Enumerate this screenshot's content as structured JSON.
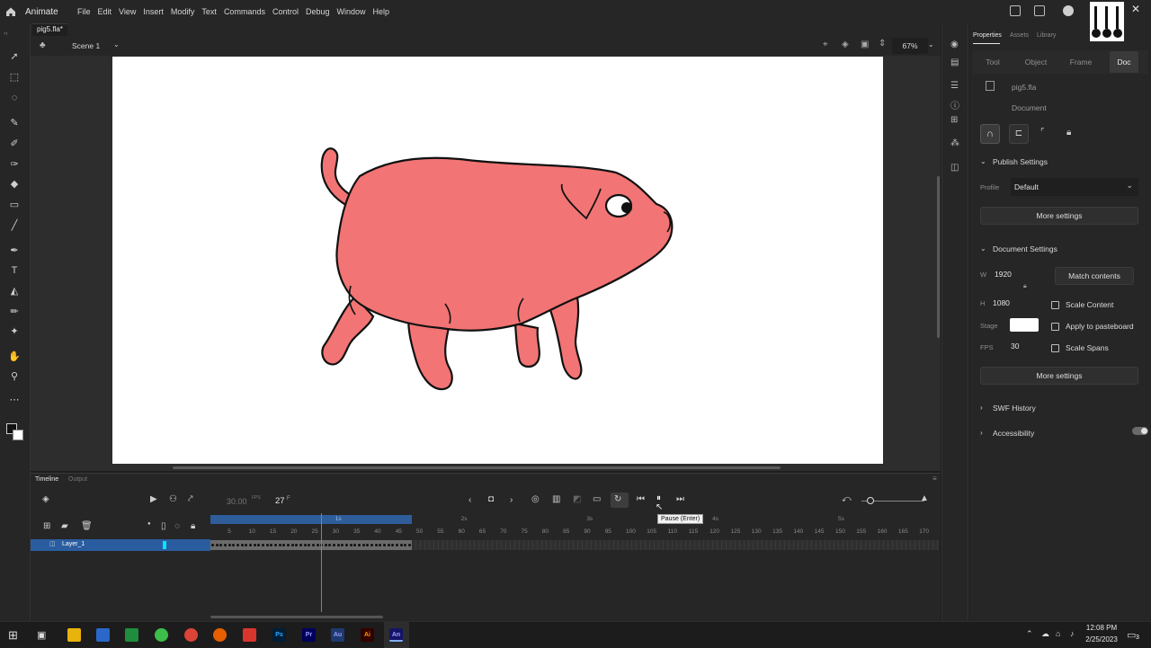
{
  "app": {
    "name": "Animate"
  },
  "menu": [
    "File",
    "Edit",
    "View",
    "Insert",
    "Modify",
    "Text",
    "Commands",
    "Control",
    "Debug",
    "Window",
    "Help"
  ],
  "document": {
    "tab": "pig5.fla*",
    "scene": "Scene 1",
    "zoom": "67%"
  },
  "panel": {
    "tabs": [
      "Properties",
      "Assets",
      "Library"
    ],
    "subtabs": [
      "Tool",
      "Object",
      "Frame",
      "Doc"
    ],
    "file_name": "pig5.fla",
    "doc_label": "Document",
    "publish": {
      "title": "Publish Settings",
      "profile_label": "Profile",
      "profile_value": "Default",
      "more": "More settings"
    },
    "docsettings": {
      "title": "Document Settings",
      "w_label": "W",
      "w": "1920",
      "h_label": "H",
      "h": "1080",
      "match": "Match contents",
      "scale_content": "Scale Content",
      "stage_label": "Stage",
      "apply_paste": "Apply to pasteboard",
      "fps_label": "FPS",
      "fps": "30",
      "scale_spans": "Scale Spans",
      "more": "More settings",
      "stage_color": "#ffffff"
    },
    "swf": "SWF History",
    "access": "Accessibility"
  },
  "timeline": {
    "tabs": [
      "Timeline",
      "Output"
    ],
    "fps": "30.00",
    "fps_unit": "FPS",
    "frame": "27",
    "frame_unit": "F",
    "layer": "Layer_1",
    "tooltip": "Pause (Enter)",
    "ticks": [
      "5",
      "10",
      "15",
      "20",
      "25",
      "30",
      "35",
      "40",
      "45",
      "50",
      "55",
      "60",
      "65",
      "70",
      "75",
      "80",
      "85",
      "90",
      "95",
      "100",
      "105",
      "110",
      "115",
      "120",
      "125",
      "130",
      "135",
      "140",
      "145",
      "150",
      "155",
      "160",
      "165",
      "170"
    ],
    "secs": [
      "1s",
      "2s",
      "3s",
      "4s",
      "5s"
    ]
  },
  "taskbar": {
    "time": "12:08 PM",
    "date": "2/25/2023",
    "notif": "3",
    "apps": [
      "Ps",
      "Pr",
      "Au",
      "Ai",
      "An"
    ]
  },
  "colors": {
    "accent": "#1473e6",
    "pig": "#f27474",
    "playhead": "#4a90e2"
  }
}
